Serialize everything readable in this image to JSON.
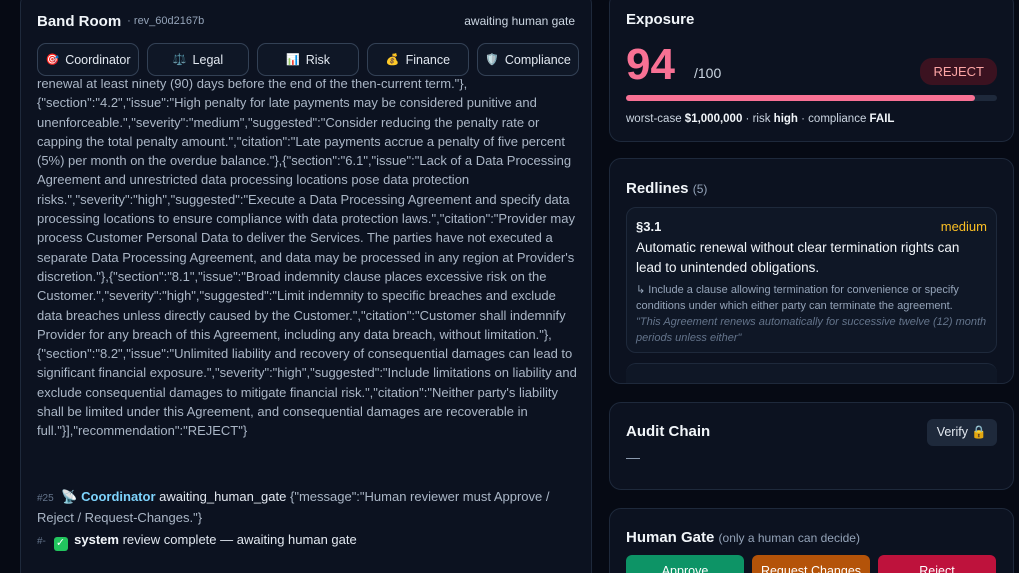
{
  "band_room": {
    "title": "Band Room",
    "revision": "rev_60d2167b",
    "status": "awaiting human gate",
    "agents": [
      {
        "label": "Coordinator",
        "icon": "🎯"
      },
      {
        "label": "Legal",
        "icon": "⚖️"
      },
      {
        "label": "Risk",
        "icon": "📊"
      },
      {
        "label": "Finance",
        "icon": "💰"
      },
      {
        "label": "Compliance",
        "icon": "🛡️"
      }
    ],
    "log_text": "renewal at least ninety (90) days before the end of the then-current term.\"},{\"section\":\"4.2\",\"issue\":\"High penalty for late payments may be considered punitive and unenforceable.\",\"severity\":\"medium\",\"suggested\":\"Consider reducing the penalty rate or capping the total penalty amount.\",\"citation\":\"Late payments accrue a penalty of five percent (5%) per month on the overdue balance.\"},{\"section\":\"6.1\",\"issue\":\"Lack of a Data Processing Agreement and unrestricted data processing locations pose data protection risks.\",\"severity\":\"high\",\"suggested\":\"Execute a Data Processing Agreement and specify data processing locations to ensure compliance with data protection laws.\",\"citation\":\"Provider may process Customer Personal Data to deliver the Services. The parties have not executed a separate Data Processing Agreement, and data may be processed in any region at Provider's discretion.\"},{\"section\":\"8.1\",\"issue\":\"Broad indemnity clause places excessive risk on the Customer.\",\"severity\":\"high\",\"suggested\":\"Limit indemnity to specific breaches and exclude data breaches unless directly caused by the Customer.\",\"citation\":\"Customer shall indemnify Provider for any breach of this Agreement, including any data breach, without limitation.\"},{\"section\":\"8.2\",\"issue\":\"Unlimited liability and recovery of consequential damages can lead to significant financial exposure.\",\"severity\":\"high\",\"suggested\":\"Include limitations on liability and exclude consequential damages to mitigate financial risk.\",\"citation\":\"Neither party's liability shall be limited under this Agreement, and consequential damages are recoverable in full.\"}],\"recommendation\":\"REJECT\"}",
    "entry25": {
      "num": "#25",
      "icon": "📡",
      "agent": "Coordinator",
      "event": "awaiting_human_gate",
      "message": "{\"message\":\"Human reviewer must Approve / Reject / Request-Changes.\"}"
    },
    "entry_sys": {
      "num": "#-",
      "check": "✓",
      "agent": "system",
      "text": "review complete — awaiting human gate"
    }
  },
  "exposure": {
    "title": "Exposure",
    "score": "94",
    "score_max": "/100",
    "score_fraction": 0.94,
    "badge": "REJECT",
    "note_prefix": "worst-case ",
    "worst_case": "$1,000,000",
    "note_mid": " · risk ",
    "risk": "high",
    "note_mid2": " · compliance ",
    "compliance": "FAIL"
  },
  "redlines": {
    "title": "Redlines",
    "count": "(5)",
    "item": {
      "section": "§3.1",
      "severity": "medium",
      "issue": "Automatic renewal without clear termination rights can lead to unintended obligations.",
      "suggested": "↳ Include a clause allowing termination for convenience or specify conditions under which either party can terminate the agreement.",
      "citation": "\"This Agreement renews automatically for successive twelve (12) month periods unless either\""
    }
  },
  "audit": {
    "title": "Audit Chain",
    "verify_label": "Verify 🔒",
    "value": "—"
  },
  "gate": {
    "title": "Human Gate",
    "note": "(only a human can decide)",
    "approve": "Approve",
    "changes": "Request Changes",
    "reject": "Reject"
  },
  "colors": {
    "accent_score": "#f87194",
    "severity_medium": "#fbbf24",
    "approve": "#0d9466",
    "changes": "#b45309",
    "reject": "#be123c"
  }
}
